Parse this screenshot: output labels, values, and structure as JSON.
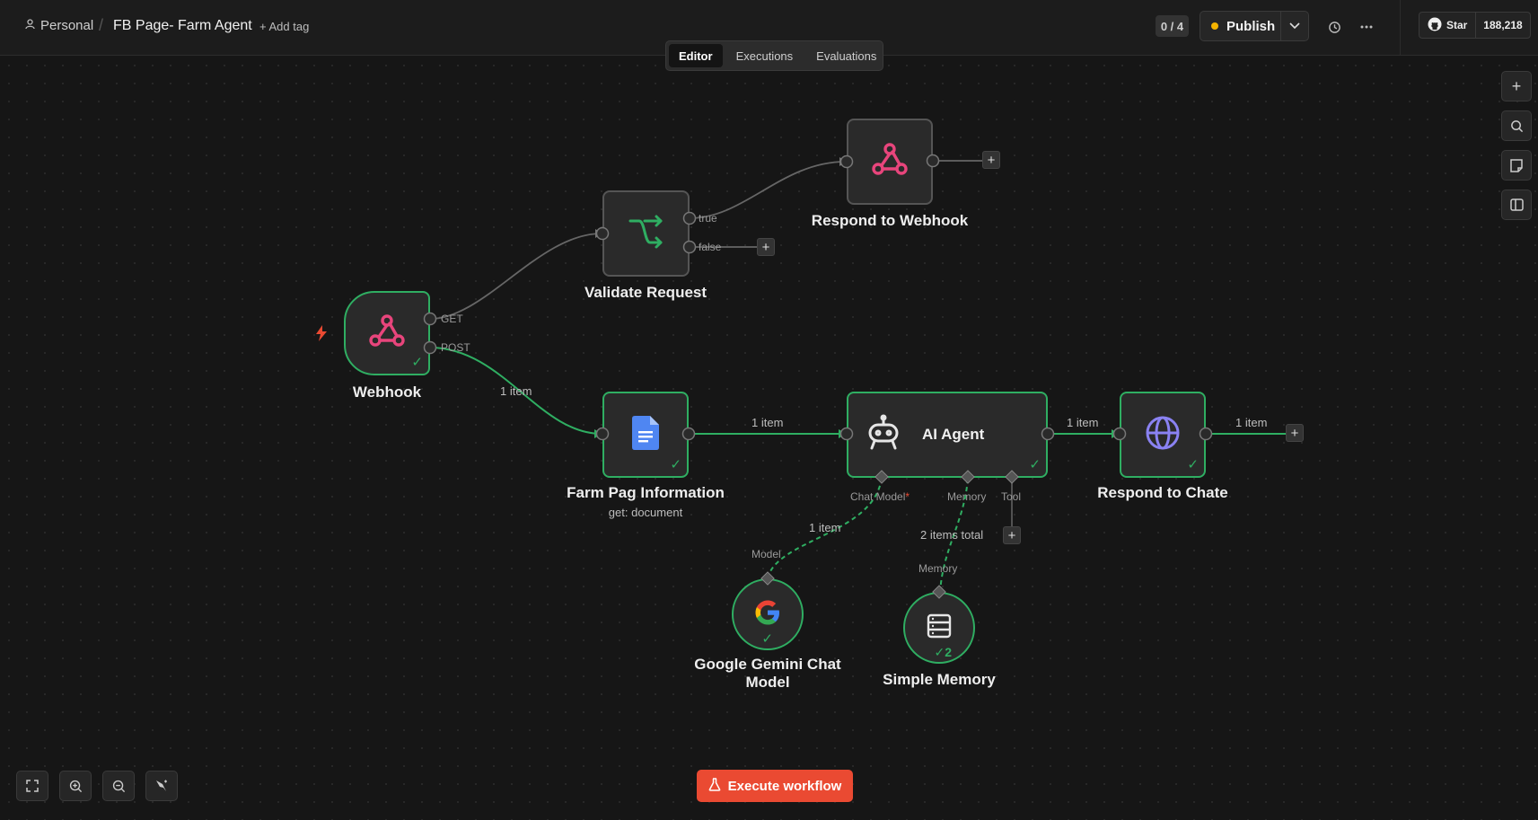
{
  "header": {
    "breadcrumb_project": "Personal",
    "breadcrumb_separator": "/",
    "workflow_title": "FB Page- Farm Agent",
    "add_tag": "+ Add tag",
    "counter": "0 / 4",
    "publish_label": "Publish",
    "github_star": "Star",
    "github_count": "188,218"
  },
  "tabs": [
    "Editor",
    "Executions",
    "Evaluations"
  ],
  "nodes": {
    "webhook": {
      "label": "Webhook",
      "out_get": "GET",
      "out_post": "POST"
    },
    "validate": {
      "label": "Validate Request",
      "out_true": "true",
      "out_false": "false"
    },
    "respond_webhook": {
      "label": "Respond to Webhook"
    },
    "farm_info": {
      "label": "Farm Pag Information",
      "subtitle": "get: document"
    },
    "ai_agent": {
      "label": "AI Agent",
      "port_chat_model": "Chat Model",
      "port_required": "*",
      "port_memory": "Memory",
      "port_tool": "Tool"
    },
    "respond_chat": {
      "label": "Respond to Chate"
    },
    "gemini": {
      "label_line1": "Google Gemini Chat",
      "label_line2": "Model",
      "port": "Model"
    },
    "memory": {
      "label": "Simple Memory",
      "port": "Memory",
      "run_count": "2"
    }
  },
  "edges": {
    "webhook_to_farm": "1 item",
    "farm_to_agent": "1 item",
    "agent_to_chat": "1 item",
    "chat_out": "1 item",
    "gemini_to_agent": "1 item",
    "memory_to_agent": "2 items total"
  },
  "execute_label": "Execute workflow",
  "colors": {
    "success": "#2fae62",
    "execute": "#ea4a32",
    "publish_dot": "#f5b400",
    "webhook_icon": "#e8457c",
    "doc_icon": "#4f86f2",
    "globe_icon": "#8a82f2"
  }
}
